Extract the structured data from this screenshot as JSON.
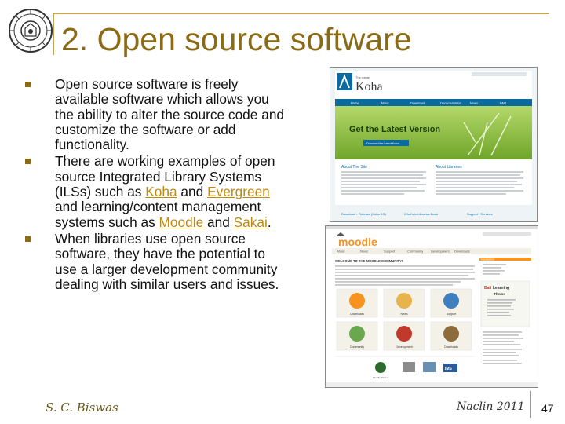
{
  "slide": {
    "title": "2. Open source software",
    "bullets": [
      {
        "segments": [
          {
            "text": "Open source software is freely available software which allows you the ability to alter the source code and customize the software or add functionality.",
            "link": false
          }
        ]
      },
      {
        "segments": [
          {
            "text": "There are working examples of open source Integrated Library Systems (ILSs) such as ",
            "link": false
          },
          {
            "text": "Koha",
            "link": true
          },
          {
            "text": " and ",
            "link": false
          },
          {
            "text": "Evergreen",
            "link": true
          },
          {
            "text": " and learning/content management systems such as ",
            "link": false
          },
          {
            "text": "Moodle",
            "link": true
          },
          {
            "text": " and ",
            "link": false
          },
          {
            "text": "Sakai",
            "link": true
          },
          {
            "text": ".",
            "link": false
          }
        ]
      },
      {
        "segments": [
          {
            "text": "When libraries use open source software, they have the potential to use a larger development community dealing with similar users and issues.",
            "link": false
          }
        ]
      }
    ]
  },
  "koha_screenshot": {
    "logo_text": "Koha",
    "logo_small": "The name",
    "nav": [
      "Home",
      "About",
      "Download",
      "Documentation",
      "News",
      "FAQ"
    ],
    "banner": "Get the Latest Version",
    "banner_btn": "Download the Latest Koha",
    "about_left": "About The Site",
    "about_right": "About Libraries",
    "bottom_links": [
      "Download :: Release (Koha 3.2)",
      "What's in Libraries Book",
      "Support : Services"
    ]
  },
  "moodle_screenshot": {
    "logo_text": "moodle",
    "nav": [
      "About",
      "News",
      "Support",
      "Community",
      "Development",
      "Downloads"
    ],
    "welcome": "WELCOME TO THE MOODLE COMMUNITY!",
    "tiles": [
      "Downloads",
      "News",
      "Support",
      "Community",
      "Development",
      "Downloads"
    ],
    "side_heading": "Navigation",
    "partner_text": "Moodle Partner"
  },
  "footer": {
    "author": "S. C. Biswas",
    "event": "Naclin 2011",
    "page_number": "47"
  },
  "colors": {
    "title": "#8a6a14",
    "accent": "#c6a255",
    "link": "#c08a10",
    "koha_blue": "#0b6aa0",
    "moodle_orange": "#f7931e"
  }
}
